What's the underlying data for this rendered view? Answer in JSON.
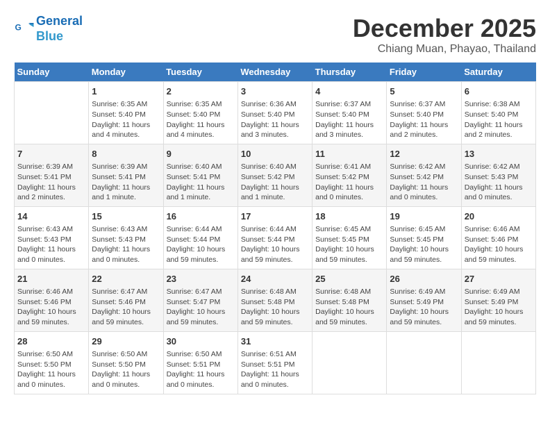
{
  "header": {
    "logo_line1": "General",
    "logo_line2": "Blue",
    "month": "December 2025",
    "location": "Chiang Muan, Phayao, Thailand"
  },
  "weekdays": [
    "Sunday",
    "Monday",
    "Tuesday",
    "Wednesday",
    "Thursday",
    "Friday",
    "Saturday"
  ],
  "weeks": [
    [
      {
        "day": "",
        "info": ""
      },
      {
        "day": "1",
        "info": "Sunrise: 6:35 AM\nSunset: 5:40 PM\nDaylight: 11 hours\nand 4 minutes."
      },
      {
        "day": "2",
        "info": "Sunrise: 6:35 AM\nSunset: 5:40 PM\nDaylight: 11 hours\nand 4 minutes."
      },
      {
        "day": "3",
        "info": "Sunrise: 6:36 AM\nSunset: 5:40 PM\nDaylight: 11 hours\nand 3 minutes."
      },
      {
        "day": "4",
        "info": "Sunrise: 6:37 AM\nSunset: 5:40 PM\nDaylight: 11 hours\nand 3 minutes."
      },
      {
        "day": "5",
        "info": "Sunrise: 6:37 AM\nSunset: 5:40 PM\nDaylight: 11 hours\nand 2 minutes."
      },
      {
        "day": "6",
        "info": "Sunrise: 6:38 AM\nSunset: 5:40 PM\nDaylight: 11 hours\nand 2 minutes."
      }
    ],
    [
      {
        "day": "7",
        "info": "Sunrise: 6:39 AM\nSunset: 5:41 PM\nDaylight: 11 hours\nand 2 minutes."
      },
      {
        "day": "8",
        "info": "Sunrise: 6:39 AM\nSunset: 5:41 PM\nDaylight: 11 hours\nand 1 minute."
      },
      {
        "day": "9",
        "info": "Sunrise: 6:40 AM\nSunset: 5:41 PM\nDaylight: 11 hours\nand 1 minute."
      },
      {
        "day": "10",
        "info": "Sunrise: 6:40 AM\nSunset: 5:42 PM\nDaylight: 11 hours\nand 1 minute."
      },
      {
        "day": "11",
        "info": "Sunrise: 6:41 AM\nSunset: 5:42 PM\nDaylight: 11 hours\nand 0 minutes."
      },
      {
        "day": "12",
        "info": "Sunrise: 6:42 AM\nSunset: 5:42 PM\nDaylight: 11 hours\nand 0 minutes."
      },
      {
        "day": "13",
        "info": "Sunrise: 6:42 AM\nSunset: 5:43 PM\nDaylight: 11 hours\nand 0 minutes."
      }
    ],
    [
      {
        "day": "14",
        "info": "Sunrise: 6:43 AM\nSunset: 5:43 PM\nDaylight: 11 hours\nand 0 minutes."
      },
      {
        "day": "15",
        "info": "Sunrise: 6:43 AM\nSunset: 5:43 PM\nDaylight: 11 hours\nand 0 minutes."
      },
      {
        "day": "16",
        "info": "Sunrise: 6:44 AM\nSunset: 5:44 PM\nDaylight: 10 hours\nand 59 minutes."
      },
      {
        "day": "17",
        "info": "Sunrise: 6:44 AM\nSunset: 5:44 PM\nDaylight: 10 hours\nand 59 minutes."
      },
      {
        "day": "18",
        "info": "Sunrise: 6:45 AM\nSunset: 5:45 PM\nDaylight: 10 hours\nand 59 minutes."
      },
      {
        "day": "19",
        "info": "Sunrise: 6:45 AM\nSunset: 5:45 PM\nDaylight: 10 hours\nand 59 minutes."
      },
      {
        "day": "20",
        "info": "Sunrise: 6:46 AM\nSunset: 5:46 PM\nDaylight: 10 hours\nand 59 minutes."
      }
    ],
    [
      {
        "day": "21",
        "info": "Sunrise: 6:46 AM\nSunset: 5:46 PM\nDaylight: 10 hours\nand 59 minutes."
      },
      {
        "day": "22",
        "info": "Sunrise: 6:47 AM\nSunset: 5:46 PM\nDaylight: 10 hours\nand 59 minutes."
      },
      {
        "day": "23",
        "info": "Sunrise: 6:47 AM\nSunset: 5:47 PM\nDaylight: 10 hours\nand 59 minutes."
      },
      {
        "day": "24",
        "info": "Sunrise: 6:48 AM\nSunset: 5:48 PM\nDaylight: 10 hours\nand 59 minutes."
      },
      {
        "day": "25",
        "info": "Sunrise: 6:48 AM\nSunset: 5:48 PM\nDaylight: 10 hours\nand 59 minutes."
      },
      {
        "day": "26",
        "info": "Sunrise: 6:49 AM\nSunset: 5:49 PM\nDaylight: 10 hours\nand 59 minutes."
      },
      {
        "day": "27",
        "info": "Sunrise: 6:49 AM\nSunset: 5:49 PM\nDaylight: 10 hours\nand 59 minutes."
      }
    ],
    [
      {
        "day": "28",
        "info": "Sunrise: 6:50 AM\nSunset: 5:50 PM\nDaylight: 11 hours\nand 0 minutes."
      },
      {
        "day": "29",
        "info": "Sunrise: 6:50 AM\nSunset: 5:50 PM\nDaylight: 11 hours\nand 0 minutes."
      },
      {
        "day": "30",
        "info": "Sunrise: 6:50 AM\nSunset: 5:51 PM\nDaylight: 11 hours\nand 0 minutes."
      },
      {
        "day": "31",
        "info": "Sunrise: 6:51 AM\nSunset: 5:51 PM\nDaylight: 11 hours\nand 0 minutes."
      },
      {
        "day": "",
        "info": ""
      },
      {
        "day": "",
        "info": ""
      },
      {
        "day": "",
        "info": ""
      }
    ]
  ]
}
